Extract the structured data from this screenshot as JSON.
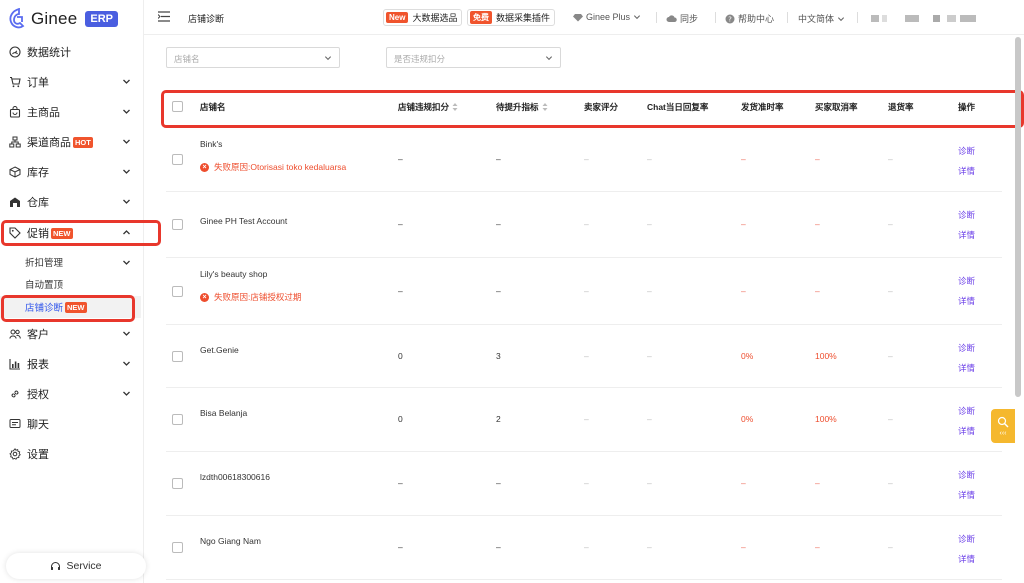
{
  "brand": {
    "name": "Ginee",
    "badge": "ERP"
  },
  "sidebar": {
    "items": [
      {
        "label": "数据统计",
        "icon": "dashboard-icon"
      },
      {
        "label": "订单",
        "icon": "cart-icon"
      },
      {
        "label": "主商品",
        "icon": "bag-icon"
      },
      {
        "label": "渠道商品",
        "icon": "channel-icon",
        "badge": "HOT"
      },
      {
        "label": "库存",
        "icon": "box-icon"
      },
      {
        "label": "仓库",
        "icon": "warehouse-icon"
      },
      {
        "label": "促销",
        "icon": "tag-icon",
        "badge": "NEW"
      },
      {
        "label": "客户",
        "icon": "users-icon"
      },
      {
        "label": "报表",
        "icon": "chart-icon"
      },
      {
        "label": "授权",
        "icon": "link-icon"
      },
      {
        "label": "聊天",
        "icon": "chat-icon"
      },
      {
        "label": "设置",
        "icon": "gear-icon"
      }
    ],
    "sub_items": [
      {
        "label": "折扣管理"
      },
      {
        "label": "自动置顶"
      },
      {
        "label": "店铺诊断",
        "badge": "NEW"
      }
    ],
    "service_label": "Service"
  },
  "header": {
    "title": "店铺诊断",
    "bigdata": {
      "tag": "New",
      "label": "大数据选品"
    },
    "plugin": {
      "tag": "免费",
      "label": "数据采集插件"
    },
    "ginee_plus": "Ginee Plus",
    "sync": "同步",
    "help": "帮助中心",
    "language": "中文简体"
  },
  "filters": {
    "shop_placeholder": "店铺名",
    "violation_placeholder": "是否违规扣分"
  },
  "table": {
    "headers": {
      "shop": "店铺名",
      "violation": "店铺违规扣分",
      "pending": "待提升指标",
      "rating": "卖家评分",
      "chat": "Chat当日回复率",
      "ontime": "发货准时率",
      "cancel": "买家取消率",
      "return": "退货率",
      "action": "操作"
    },
    "rows": [
      {
        "shop": "Bink's",
        "error": "失败原因:Otorisasi toko kedaluarsa",
        "violation": "–",
        "pending": "–",
        "rating": "–",
        "chat": "–",
        "ontime": "–",
        "cancel": "–",
        "return": "–",
        "diag": "诊断",
        "detail": "详情"
      },
      {
        "shop": "Ginee PH Test Account",
        "error": "",
        "violation": "–",
        "pending": "–",
        "rating": "–",
        "chat": "–",
        "ontime": "–",
        "cancel": "–",
        "return": "–",
        "diag": "诊断",
        "detail": "详情"
      },
      {
        "shop": "Lily's beauty shop",
        "error": "失败原因:店铺授权过期",
        "violation": "–",
        "pending": "–",
        "rating": "–",
        "chat": "–",
        "ontime": "–",
        "cancel": "–",
        "return": "–",
        "diag": "诊断",
        "detail": "详情"
      },
      {
        "shop": "Get.Genie",
        "error": "",
        "violation": "0",
        "pending": "3",
        "rating": "–",
        "chat": "–",
        "ontime": "0%",
        "cancel": "100%",
        "return": "–",
        "diag": "诊断",
        "detail": "详情"
      },
      {
        "shop": "Bisa Belanja",
        "error": "",
        "violation": "0",
        "pending": "2",
        "rating": "–",
        "chat": "–",
        "ontime": "0%",
        "cancel": "100%",
        "return": "–",
        "diag": "诊断",
        "detail": "详情"
      },
      {
        "shop": "lzdth00618300616",
        "error": "",
        "violation": "–",
        "pending": "–",
        "rating": "–",
        "chat": "–",
        "ontime": "–",
        "cancel": "–",
        "return": "–",
        "diag": "诊断",
        "detail": "详情"
      },
      {
        "shop": "Ngo Giang Nam",
        "error": "",
        "violation": "–",
        "pending": "–",
        "rating": "–",
        "chat": "–",
        "ontime": "–",
        "cancel": "–",
        "return": "–",
        "diag": "诊断",
        "detail": "详情"
      }
    ]
  },
  "colors": {
    "accent": "#4a5ee0",
    "danger": "#ee4d2d",
    "link": "#6a3ee8",
    "highlight_box": "#e8372c",
    "helper": "#f5b82e"
  }
}
